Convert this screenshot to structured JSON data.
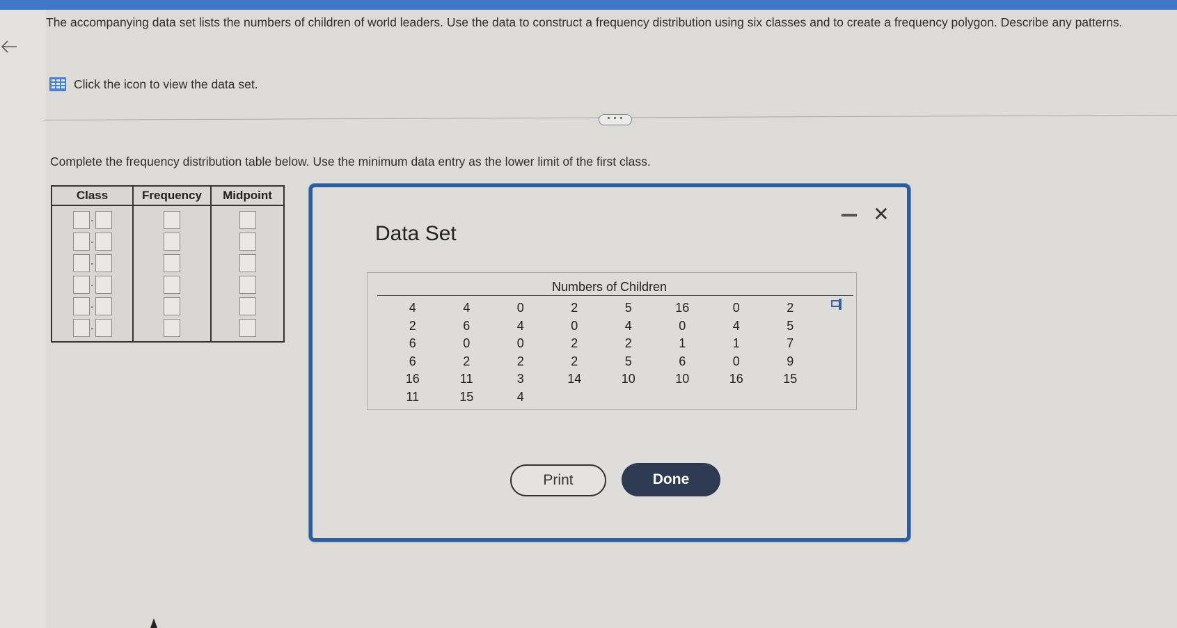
{
  "question": {
    "text": "The accompanying data set lists the numbers of children of world leaders. Use the data to construct a frequency distribution using six classes and to create a frequency polygon. Describe any patterns."
  },
  "dataset_link": {
    "label": "Click the icon to view the data set."
  },
  "expand_pill": {
    "label": "• • •"
  },
  "instruction": {
    "text": "Complete the frequency distribution table below. Use the minimum data entry as the lower limit of the first class."
  },
  "freq_table": {
    "headers": {
      "class": "Class",
      "frequency": "Frequency",
      "midpoint": "Midpoint"
    },
    "dash": "-",
    "row_count": 6
  },
  "modal": {
    "title": "Data Set",
    "close_label": "✕",
    "data_header": "Numbers of Children",
    "columns": [
      [
        "4",
        "2",
        "6",
        "6",
        "16",
        "11"
      ],
      [
        "4",
        "6",
        "0",
        "2",
        "11",
        "15"
      ],
      [
        "0",
        "4",
        "0",
        "2",
        "3",
        "4"
      ],
      [
        "2",
        "0",
        "2",
        "2",
        "14"
      ],
      [
        "5",
        "4",
        "2",
        "5",
        "10"
      ],
      [
        "16",
        "0",
        "1",
        "6",
        "10"
      ],
      [
        "0",
        "4",
        "1",
        "0",
        "16"
      ],
      [
        "2",
        "5",
        "7",
        "9",
        "15"
      ]
    ],
    "print_label": "Print",
    "done_label": "Done"
  },
  "colors": {
    "accent": "#3f79c6",
    "modal_border": "#2f5d9c",
    "done_bg": "#2e3a52"
  }
}
